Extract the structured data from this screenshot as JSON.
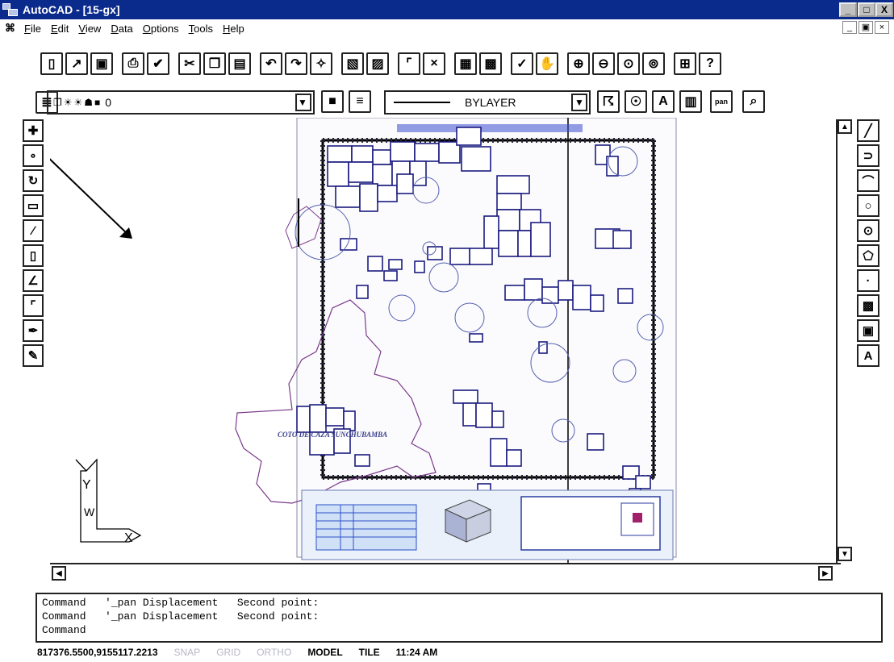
{
  "window": {
    "title": "AutoCAD - [15-gx]",
    "min": "_",
    "max": "□",
    "close": "X"
  },
  "menu": [
    "File",
    "Edit",
    "View",
    "Data",
    "Options",
    "Tools",
    "Help"
  ],
  "layer": {
    "value": "0",
    "linetype": "BYLAYER"
  },
  "drawing": {
    "map_label": "COTO DE CAZA SUNCHUBAMBA",
    "axis_y": "Y",
    "axis_w": "W",
    "axis_x": "X"
  },
  "command": {
    "lines": [
      "Command   '_pan Displacement   Second point:",
      "Command   '_pan Displacement   Second point:",
      "Command"
    ]
  },
  "status": {
    "coords": "817376.5500,9155117.2213",
    "snap": "SNAP",
    "grid": "GRID",
    "ortho": "ORTHO",
    "model": "MODEL",
    "tile": "TILE",
    "time": "11:24 AM"
  }
}
